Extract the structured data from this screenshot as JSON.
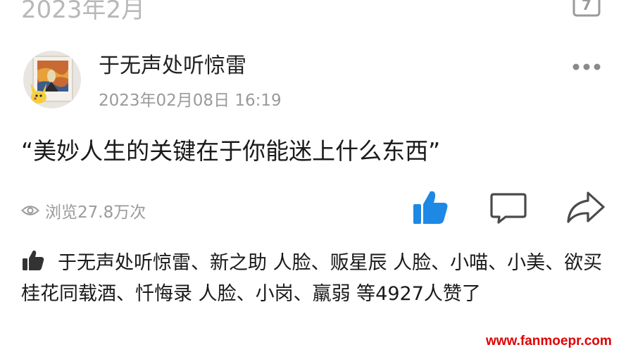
{
  "header": {
    "month_label": "2023年2月",
    "calendar_day": "7"
  },
  "post": {
    "author": "于无声处听惊雷",
    "timestamp": "2023年02月08日 16:19",
    "text": "“美妙人生的关键在于你能迷上什么东西”",
    "views": "浏览27.8万次"
  },
  "icons": {
    "calendar": "calendar-icon",
    "more": "more-dots-icon",
    "views": "eye-icon",
    "like": "thumbs-up-icon",
    "comment": "comment-bubble-icon",
    "share": "share-arrow-icon",
    "likers": "thumbs-up-small-icon"
  },
  "likes": {
    "text": "于无声处听惊雷、新之助 人脸、贩星辰 人脸、小喵、小美、欲买桂花同载酒、忏悔录 人脸、小岗、羸弱 等4927人赞了"
  },
  "watermark": "www.fanmoepr.com",
  "colors": {
    "like_blue": "#1e88e5",
    "muted_gray": "#9a9a9a",
    "watermark_red": "#e00000"
  }
}
